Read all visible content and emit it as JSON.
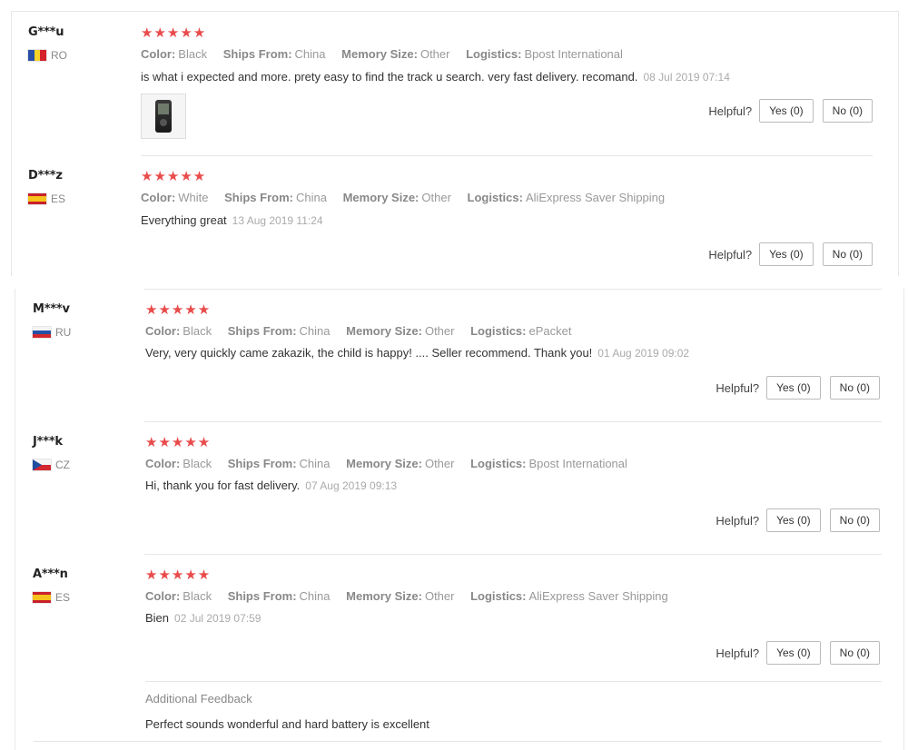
{
  "labels": {
    "color": "Color:",
    "ships_from": "Ships From:",
    "memory_size": "Memory Size:",
    "logistics": "Logistics:",
    "helpful": "Helpful?",
    "additional_feedback": "Additional Feedback"
  },
  "colors": {
    "stars": "#e94b4b",
    "divider": "#e6e6e6"
  },
  "reviews": [
    {
      "user": "G***u",
      "country": "RO",
      "stars": "★★★★★",
      "color": "Black",
      "ships_from": "China",
      "memory_size": "Other",
      "logistics": "Bpost International",
      "text": "is what i expected and more. prety easy to find the track u search. very fast delivery. recomand.",
      "date": "08 Jul 2019 07:14",
      "yes": "Yes (0)",
      "no": "No (0)",
      "photo_icon": "mp3-player-photo"
    },
    {
      "user": "D***z",
      "country": "ES",
      "stars": "★★★★★",
      "color": "White",
      "ships_from": "China",
      "memory_size": "Other",
      "logistics": "AliExpress Saver Shipping",
      "text": "Everything great",
      "date": "13 Aug 2019 11:24",
      "yes": "Yes (0)",
      "no": "No (0)"
    },
    {
      "user": "M***v",
      "country": "RU",
      "stars": "★★★★★",
      "color": "Black",
      "ships_from": "China",
      "memory_size": "Other",
      "logistics": "ePacket",
      "text": "Very, very quickly came zakazik, the child is happy! .... Seller recommend. Thank you!",
      "date": "01 Aug 2019 09:02",
      "yes": "Yes (0)",
      "no": "No (0)"
    },
    {
      "user": "J***k",
      "country": "CZ",
      "stars": "★★★★★",
      "color": "Black",
      "ships_from": "China",
      "memory_size": "Other",
      "logistics": "Bpost International",
      "text": "Hi, thank you for fast delivery.",
      "date": "07 Aug 2019 09:13",
      "yes": "Yes (0)",
      "no": "No (0)"
    },
    {
      "user": "A***n",
      "country": "ES",
      "stars": "★★★★★",
      "color": "Black",
      "ships_from": "China",
      "memory_size": "Other",
      "logistics": "AliExpress Saver Shipping",
      "text": "Bien",
      "date": "02 Jul 2019 07:59",
      "yes": "Yes (0)",
      "no": "No (0)",
      "additional_feedback": "Perfect sounds wonderful and hard battery is excellent"
    }
  ]
}
